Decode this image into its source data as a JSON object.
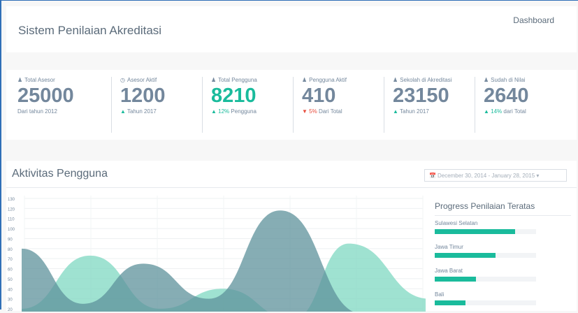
{
  "header": {
    "title": "Sistem Penilaian Akreditasi",
    "breadcrumb": "Dashboard"
  },
  "stats": [
    {
      "label": "Total Asesor",
      "icon": "user-icon",
      "value": "25000",
      "sub_pre": "",
      "sub_val": "",
      "sub_text": "Dari tahun 2012",
      "color": "#73879c"
    },
    {
      "label": "Asesor Aktif",
      "icon": "clock-icon",
      "value": "1200",
      "sub_pre": "▲",
      "sub_val": "",
      "sub_text": "Tahun 2017",
      "color": "#73879c"
    },
    {
      "label": "Total Pengguna",
      "icon": "user-icon",
      "value": "8210",
      "sub_pre": "▲",
      "sub_val": "12%",
      "sub_text": "Pengguna",
      "color": "#1abb9c"
    },
    {
      "label": "Pengguna Aktif",
      "icon": "user-icon",
      "value": "410",
      "sub_pre": "▼",
      "sub_val": "5%",
      "sub_text": "Dari Total",
      "color": "#73879c"
    },
    {
      "label": "Sekolah di Akreditasi",
      "icon": "user-icon",
      "value": "23150",
      "sub_pre": "▲",
      "sub_val": "",
      "sub_text": "Tahun 2017",
      "color": "#73879c"
    },
    {
      "label": "Sudah di Nilai",
      "icon": "user-icon",
      "value": "2640",
      "sub_pre": "▲",
      "sub_val": "14%",
      "sub_text": "dari Total",
      "color": "#73879c"
    }
  ],
  "activity": {
    "title": "Aktivitas Pengguna",
    "date_range": "December 30, 2014 - January 28, 2015"
  },
  "chart_data": {
    "type": "area",
    "yticks": [
      130,
      120,
      110,
      100,
      90,
      80,
      70,
      60,
      50,
      40,
      30,
      20
    ],
    "ylim": [
      20,
      130
    ],
    "series": [
      {
        "values": [
          80,
          25,
          65,
          30,
          118,
          15
        ]
      },
      {
        "values": [
          20,
          73,
          20,
          40,
          10,
          85,
          30
        ]
      }
    ],
    "colors": [
      "#5d929b",
      "#7fd8c2"
    ]
  },
  "progress": {
    "title": "Progress Penilaian Teratas",
    "items": [
      {
        "label": "Sulawesi Selatan",
        "value": 0.79
      },
      {
        "label": "Jawa Timur",
        "value": 0.6
      },
      {
        "label": "Jawa Barat",
        "value": 0.41
      },
      {
        "label": "Bali",
        "value": 0.3
      }
    ]
  }
}
